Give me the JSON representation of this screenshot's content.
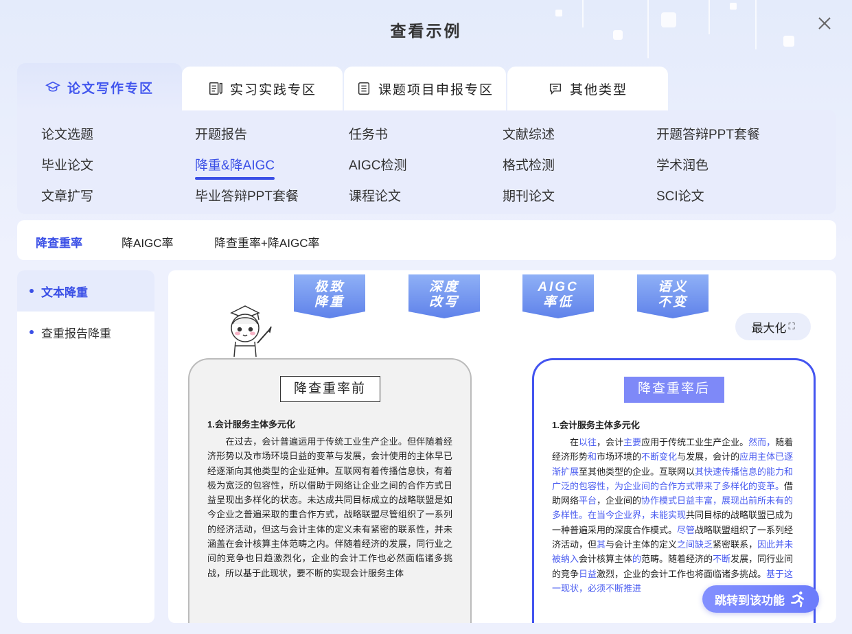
{
  "modal": {
    "title": "查看示例"
  },
  "tabs": [
    {
      "label": "论文写作专区",
      "icon": "graduation-cap-icon"
    },
    {
      "label": "实习实践专区",
      "icon": "document-pen-icon"
    },
    {
      "label": "课题项目申报专区",
      "icon": "list-document-icon"
    },
    {
      "label": "其他类型",
      "icon": "message-icon"
    }
  ],
  "categories": [
    [
      "论文选题",
      "开题报告",
      "任务书",
      "文献综述",
      "开题答辩PPT套餐"
    ],
    [
      "毕业论文",
      "降重&降AIGC",
      "AIGC检测",
      "格式检测",
      "学术润色"
    ],
    [
      "文章扩写",
      "毕业答辩PPT套餐",
      "课程论文",
      "期刊论文",
      "SCI论文"
    ]
  ],
  "sub_tabs": [
    "降查重率",
    "降AIGC率",
    "降查重率+降AIGC率"
  ],
  "sidebar": [
    "文本降重",
    "查重报告降重"
  ],
  "ribbons": [
    {
      "line1": "极致",
      "line2": "降重"
    },
    {
      "line1": "深度",
      "line2": "改写"
    },
    {
      "line1": "AIGC",
      "line2": "率低"
    },
    {
      "line1": "语义",
      "line2": "不变"
    }
  ],
  "maximize_label": "最大化",
  "before": {
    "title": "降查重率前",
    "heading": "1.会计服务主体多元化",
    "text": "　　在过去，会计普遍运用于传统工业生产企业。但伴随着经济形势以及市场环境日益的变革与发展，会计使用的主体早已经逐渐向其他类型的企业延伸。互联网有着传播信息快，有着极为宽泛的包容性，所以借助于网络让企业之间的合作方式日益呈现出多样化的状态。未达成共同目标成立的战略联盟是如今企业之普遍采取的重合作方式，战略联盟尽管组织了一系列的经济活动，但这与会计主体的定义未有紧密的联系性，并未涵盖在会计核算主体范畴之内。伴随着经济的发展，同行业之间的竞争也日趋激烈化，企业的会计工作也必然面临诸多挑战，所以基于此现状，要不断的实现会计服务主体"
  },
  "after": {
    "title": "降查重率后",
    "heading": "1.会计服务主体多元化",
    "segments": [
      [
        "　　在",
        false
      ],
      [
        "以往",
        true
      ],
      [
        "，会计",
        false
      ],
      [
        "主要",
        true
      ],
      [
        "应用于传统工业生产企业。",
        false
      ],
      [
        "然而，",
        true
      ],
      [
        "随着经济形势",
        false
      ],
      [
        "和",
        true
      ],
      [
        "市场环境的",
        false
      ],
      [
        "不断变化",
        true
      ],
      [
        "与发展，会计的",
        false
      ],
      [
        "应用主体已逐渐扩展",
        true
      ],
      [
        "至其他类型的企业。互联网以",
        false
      ],
      [
        "其快速传播信息的能力和广泛的包容性，为企业间的合作方式带来了多样化的变革。",
        true
      ],
      [
        "借助网络",
        false
      ],
      [
        "平台",
        true
      ],
      [
        "，企业间的",
        false
      ],
      [
        "协作模式日益丰富，展现出前所未有的多样性。在当今企业界，未能实现",
        true
      ],
      [
        "共同目标的战略联盟已成为一种普遍采用的深度合作模式。",
        false
      ],
      [
        "尽管",
        true
      ],
      [
        "战略联盟组织了一系列经济活动，但",
        false
      ],
      [
        "其",
        true
      ],
      [
        "与会计主体的定义",
        false
      ],
      [
        "之间缺乏",
        true
      ],
      [
        "紧密联系，",
        false
      ],
      [
        "因此并未被纳入",
        true
      ],
      [
        "会计核算主体",
        false
      ],
      [
        "的",
        true
      ],
      [
        "范畴。随着经济的",
        false
      ],
      [
        "不断",
        true
      ],
      [
        "发展，同行业间的竞争",
        false
      ],
      [
        "日益",
        true
      ],
      [
        "激烈，企业的会计工作也将面临诸多挑战。",
        false
      ],
      [
        "基于这一现状，必须不断推进",
        true
      ]
    ]
  },
  "jump_button": "跳转到该功能",
  "colors": {
    "accent": "#3a4fe6",
    "ribbon": "#6d8ff0",
    "highlight": "#4a5cf0"
  }
}
